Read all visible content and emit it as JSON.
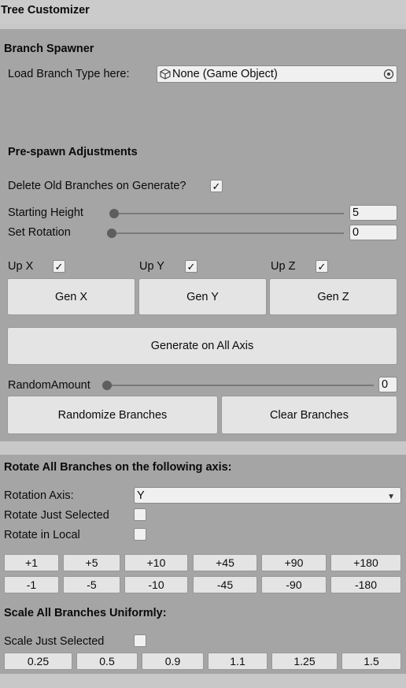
{
  "window": {
    "title": "Tree Customizer"
  },
  "branch_spawner": {
    "heading": "Branch Spawner",
    "load_label": "Load Branch Type here:",
    "object_value": "None (Game Object)"
  },
  "prespawn": {
    "heading": "Pre-spawn Adjustments",
    "delete_old_label": "Delete Old Branches on Generate?",
    "delete_old_checked": true,
    "starting_height_label": "Starting Height",
    "starting_height_value": "5",
    "set_rotation_label": "Set Rotation",
    "set_rotation_value": "0",
    "up_x_label": "Up X",
    "up_y_label": "Up Y",
    "up_z_label": "Up Z",
    "gen_x": "Gen X",
    "gen_y": "Gen Y",
    "gen_z": "Gen Z",
    "generate_all": "Generate on All Axis",
    "random_amount_label": "RandomAmount",
    "random_amount_value": "0",
    "randomize": "Randomize Branches",
    "clear": "Clear Branches"
  },
  "rotate": {
    "heading": "Rotate All Branches on the following axis:",
    "axis_label": "Rotation Axis:",
    "axis_value": "Y",
    "just_selected_label": "Rotate Just Selected",
    "in_local_label": "Rotate in Local",
    "positive": [
      "+1",
      "+5",
      "+10",
      "+45",
      "+90",
      "+180"
    ],
    "negative": [
      "-1",
      "-5",
      "-10",
      "-45",
      "-90",
      "-180"
    ]
  },
  "scale": {
    "heading": "Scale All Branches Uniformly:",
    "just_selected_label": "Scale Just Selected",
    "values": [
      "0.25",
      "0.5",
      "0.9",
      "1.1",
      "1.25",
      "1.5"
    ]
  },
  "icons": {
    "check": "✓",
    "dropdown": "▼"
  }
}
